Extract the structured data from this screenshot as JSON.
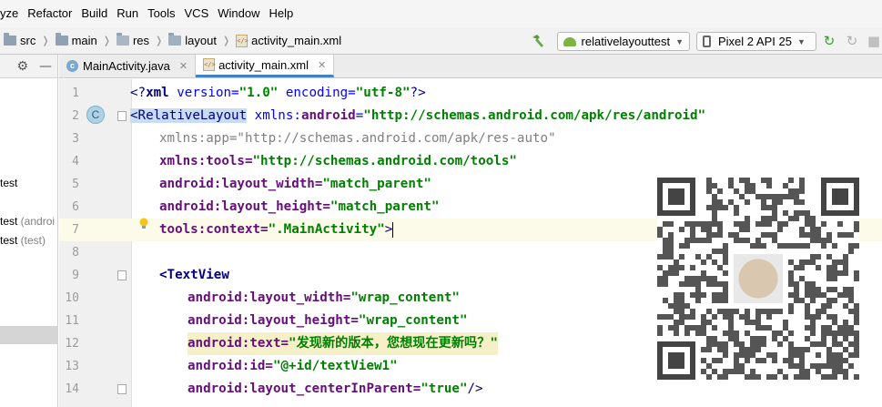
{
  "menu": [
    "yze",
    "Refactor",
    "Build",
    "Run",
    "Tools",
    "VCS",
    "Window",
    "Help"
  ],
  "breadcrumb": [
    "src",
    "main",
    "res",
    "layout",
    "activity_main.xml"
  ],
  "run_config": "relativelayouttest",
  "device": "Pixel 2 API 25",
  "left_panel": {
    "items": [
      {
        "text": "test",
        "extra": ""
      },
      {
        "text": "test",
        "extra": " (androi"
      },
      {
        "text": "test",
        "extra": " (test)"
      }
    ]
  },
  "tabs": [
    {
      "label": "MainActivity.java",
      "active": false
    },
    {
      "label": "activity_main.xml",
      "active": true
    }
  ],
  "code_lines": [
    {
      "n": "1"
    },
    {
      "n": "2"
    },
    {
      "n": "3"
    },
    {
      "n": "4"
    },
    {
      "n": "5"
    },
    {
      "n": "6"
    },
    {
      "n": "7"
    },
    {
      "n": "8"
    },
    {
      "n": "9"
    },
    {
      "n": "10"
    },
    {
      "n": "11"
    },
    {
      "n": "12"
    },
    {
      "n": "13"
    },
    {
      "n": "14"
    }
  ],
  "code": {
    "l1_open": "<?",
    "l1_xml": "xml",
    "l1_version_attr": " version=",
    "l1_version_val": "\"1.0\"",
    "l1_enc_attr": " encoding=",
    "l1_enc_val": "\"utf-8\"",
    "l1_close": "?>",
    "l2_lt": "<",
    "l2_tag": "RelativeLayout",
    "l2_attr_ns": " xmlns:",
    "l2_attr_name": "android",
    "l2_eq": "=",
    "l2_val": "\"http://schemas.android.com/apk/res/android\"",
    "l3_attr": "xmlns:app=",
    "l3_val": "\"http://schemas.android.com/apk/res-auto\"",
    "l4_attr": "xmlns:tools=",
    "l4_val": "\"http://schemas.android.com/tools\"",
    "l5_prefix": "android",
    "l5_attr": ":layout_width=",
    "l5_val": "\"match_parent\"",
    "l6_prefix": "android",
    "l6_attr": ":layout_height=",
    "l6_val": "\"match_parent\"",
    "l7_prefix": "tools",
    "l7_attr": ":context=",
    "l7_val": "\".MainActivity\"",
    "l7_close": ">",
    "l9_tag": "<TextView",
    "l10_prefix": "android",
    "l10_attr": ":layout_width=",
    "l10_val": "\"wrap_content\"",
    "l11_prefix": "android",
    "l11_attr": ":layout_height=",
    "l11_val": "\"wrap_content\"",
    "l12_prefix": "android",
    "l12_attr": ":text=",
    "l12_val": "\"发现新的版本，您想现在更新吗？\"",
    "l13_prefix": "android",
    "l13_attr": ":id=",
    "l13_val": "\"@+id/textView1\"",
    "l14_prefix": "android",
    "l14_attr": ":layout_centerInParent=",
    "l14_val": "\"true\"",
    "l14_close": "/>"
  },
  "gutter_class_marker": "C",
  "colors": {
    "tag": "#000080",
    "attribute": "#660e7a",
    "value": "#008000",
    "current_line": "#fcfae8",
    "tab_underline": "#4083c9"
  }
}
